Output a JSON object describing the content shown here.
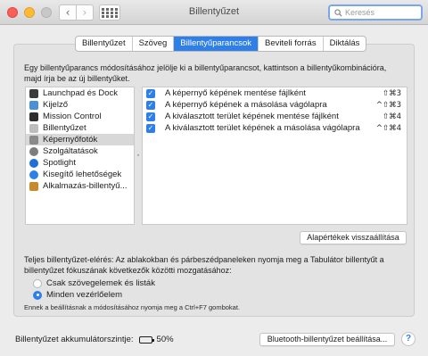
{
  "window": {
    "title": "Billentyűzet",
    "search_placeholder": "Keresés"
  },
  "tabs": [
    {
      "label": "Billentyűzet",
      "active": false
    },
    {
      "label": "Szöveg",
      "active": false
    },
    {
      "label": "Billentyűparancsok",
      "active": true
    },
    {
      "label": "Beviteli forrás",
      "active": false
    },
    {
      "label": "Diktálás",
      "active": false
    }
  ],
  "instructions": "Egy billentyűparancs módosításához jelölje ki a billentyűparancsot, kattintson a billentyűkombinációra, majd írja be az új billentyűket.",
  "categories": [
    {
      "label": "Launchpad és Dock",
      "icon": "launchpad-icon",
      "color": "#3b3b3b",
      "selected": false
    },
    {
      "label": "Kijelző",
      "icon": "display-icon",
      "color": "#4a90d9",
      "selected": false
    },
    {
      "label": "Mission Control",
      "icon": "mission-control-icon",
      "color": "#2e2e2e",
      "selected": false
    },
    {
      "label": "Billentyűzet",
      "icon": "keyboard-icon",
      "color": "#bdbdbd",
      "selected": false
    },
    {
      "label": "Képernyőfotók",
      "icon": "screenshot-icon",
      "color": "#8a8a8a",
      "selected": true
    },
    {
      "label": "Szolgáltatások",
      "icon": "services-gear-icon",
      "color": "#7d7d7d",
      "selected": false
    },
    {
      "label": "Spotlight",
      "icon": "spotlight-icon",
      "color": "#1f6fd6",
      "selected": false
    },
    {
      "label": "Kisegítő lehetőségek",
      "icon": "accessibility-icon",
      "color": "#2f7fe8",
      "selected": false
    },
    {
      "label": "Alkalmazás-billentyű...",
      "icon": "app-shortcuts-icon",
      "color": "#c98a2c",
      "selected": false
    }
  ],
  "shortcuts": [
    {
      "label": "A képernyő képének mentése fájlként",
      "keys": "⇧⌘3",
      "checked": true
    },
    {
      "label": "A képernyő képének a másolása vágólapra",
      "keys": "^⇧⌘3",
      "checked": true
    },
    {
      "label": "A kiválasztott terület képének mentése fájlként",
      "keys": "⇧⌘4",
      "checked": true
    },
    {
      "label": "A kiválasztott terület képének a másolása vágólapra",
      "keys": "^⇧⌘4",
      "checked": true
    }
  ],
  "restore_defaults_label": "Alapértékek visszaállítása",
  "full_keyboard_access": {
    "text": "Teljes billentyűzet-elérés: Az ablakokban és párbeszédpaneleken nyomja meg a Tabulátor billentyűt a billentyűzet fókuszának következők közötti mozgatásához:",
    "options": [
      {
        "label": "Csak szövegelemek és listák",
        "selected": false
      },
      {
        "label": "Minden vezérlőelem",
        "selected": true
      }
    ],
    "note": "Ennek a beállításnak a módosításához nyomja meg a Ctrl+F7 gombokat."
  },
  "battery": {
    "label": "Billentyűzet akkumulátorszintje:",
    "percent_text": "50%",
    "level": 0.5
  },
  "bluetooth_button_label": "Bluetooth-billentyűzet beállítása...",
  "help_label": "?",
  "colors": {
    "accent": "#2f7fe8"
  }
}
